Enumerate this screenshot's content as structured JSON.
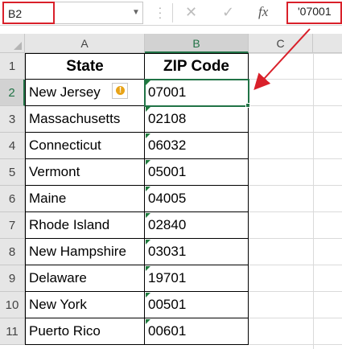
{
  "formula_bar": {
    "name_box": "B2",
    "cancel_icon": "cancel-icon",
    "enter_icon": "checkmark-icon",
    "fx_label": "fx",
    "formula_value": "'07001"
  },
  "columns": [
    "A",
    "B",
    "C"
  ],
  "rows": [
    "1",
    "2",
    "3",
    "4",
    "5",
    "6",
    "7",
    "8",
    "9",
    "10",
    "11"
  ],
  "table": {
    "headers": [
      "State",
      "ZIP Code"
    ],
    "data": [
      [
        "New Jersey",
        "07001"
      ],
      [
        "Massachusetts",
        "02108"
      ],
      [
        "Connecticut",
        "06032"
      ],
      [
        "Vermont",
        "05001"
      ],
      [
        "Maine",
        "04005"
      ],
      [
        "Rhode Island",
        "02840"
      ],
      [
        "New Hampshire",
        "03031"
      ],
      [
        "Delaware",
        "19701"
      ],
      [
        "New York",
        "00501"
      ],
      [
        "Puerto Rico",
        "00601"
      ]
    ]
  },
  "colors": {
    "accent": "#217346",
    "annotation": "#d9202a",
    "warning": "#e8a317"
  }
}
